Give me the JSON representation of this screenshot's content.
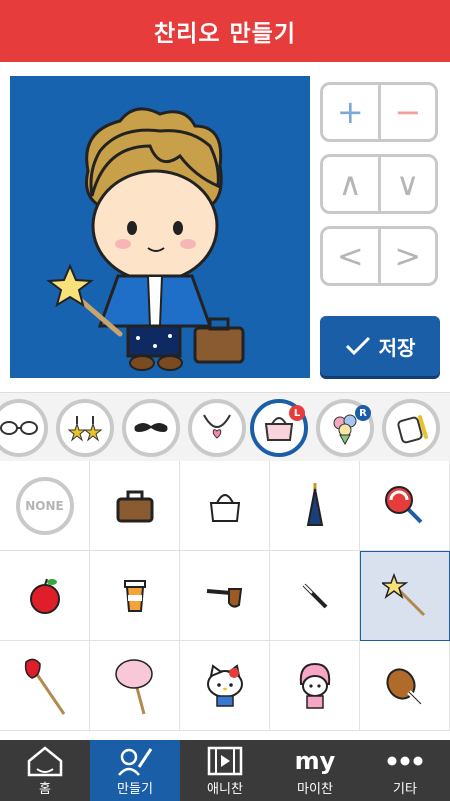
{
  "header": {
    "title": "찬리오 만들기"
  },
  "controls": {
    "zoom": {
      "plus": "+",
      "minus": "−"
    },
    "move_vertical": {
      "up": "∧",
      "down": "∨"
    },
    "move_horizontal": {
      "left": "<",
      "right": ">"
    },
    "save_label": "저장"
  },
  "categories": [
    {
      "name": "glasses"
    },
    {
      "name": "earrings"
    },
    {
      "name": "mustache"
    },
    {
      "name": "necklace"
    },
    {
      "name": "handheld-item-left",
      "badge": "L",
      "selected": true
    },
    {
      "name": "handheld-item-right",
      "badge": "R"
    },
    {
      "name": "other-item"
    }
  ],
  "grid": {
    "none_label": "NONE",
    "items": [
      "none",
      "briefcase",
      "handbag",
      "umbrella",
      "lollipop",
      "apple",
      "coffee-cup",
      "pipe",
      "baton",
      "star-wand",
      "strawberry-stick",
      "cotton-candy",
      "hello-kitty",
      "my-melody",
      "meat-drumstick"
    ],
    "selected": "star-wand"
  },
  "tabs": [
    {
      "label": "홈",
      "icon": "home-icon"
    },
    {
      "label": "만들기",
      "icon": "pen-person-icon",
      "active": true
    },
    {
      "label": "애니찬",
      "icon": "film-icon"
    },
    {
      "label": "마이찬",
      "icon_text": "my"
    },
    {
      "label": "기타",
      "icon": "more-dots-icon"
    }
  ],
  "colors": {
    "header": "#e63c3c",
    "accent": "#1a5ea8",
    "canvas": "#1763b0",
    "tabbar": "#3a3a3a"
  }
}
